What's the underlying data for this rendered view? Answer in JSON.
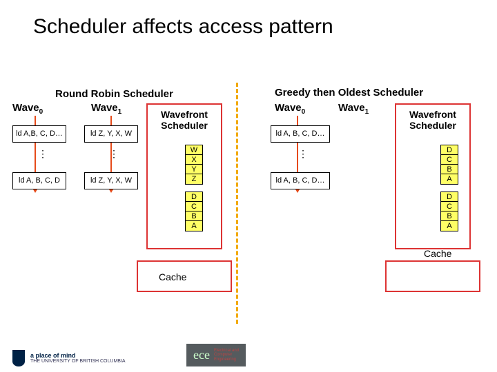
{
  "title": "Scheduler affects access pattern",
  "left": {
    "scheduler_title": "Round Robin Scheduler",
    "wave0_label": "Wave",
    "wave0_sub": "0",
    "wave1_label": "Wave",
    "wave1_sub": "1",
    "box_top_w0": "ld A,B, C, D…",
    "box_bot_w0": "ld A, B, C, D",
    "box_top_w1": "ld Z, Y, X, W",
    "box_bot_w1": "ld Z, Y, X, W",
    "wf_label": "Wavefront Scheduler",
    "stack_top": [
      "W",
      "X",
      "Y",
      "Z"
    ],
    "stack_bot": [
      "D",
      "C",
      "B",
      "A"
    ],
    "cache_label": "Cache"
  },
  "right": {
    "scheduler_title": "Greedy then Oldest Scheduler",
    "wave0_label": "Wave",
    "wave0_sub": "0",
    "wave1_label": "Wave",
    "wave1_sub": "1",
    "box_top": "ld A, B, C, D…",
    "box_bot": "ld A, B, C, D…",
    "wf_label": "Wavefront Scheduler",
    "stack_top": [
      "D",
      "C",
      "B",
      "A"
    ],
    "stack_bot": [
      "D",
      "C",
      "B",
      "A"
    ],
    "cache_label": "Cache"
  },
  "footer": {
    "line1": "a place of mind",
    "line2": "THE UNIVERSITY OF BRITISH COLUMBIA",
    "ece": "ece",
    "ece_sub1": "Electrical and",
    "ece_sub2": "Computer",
    "ece_sub3": "Engineering"
  }
}
